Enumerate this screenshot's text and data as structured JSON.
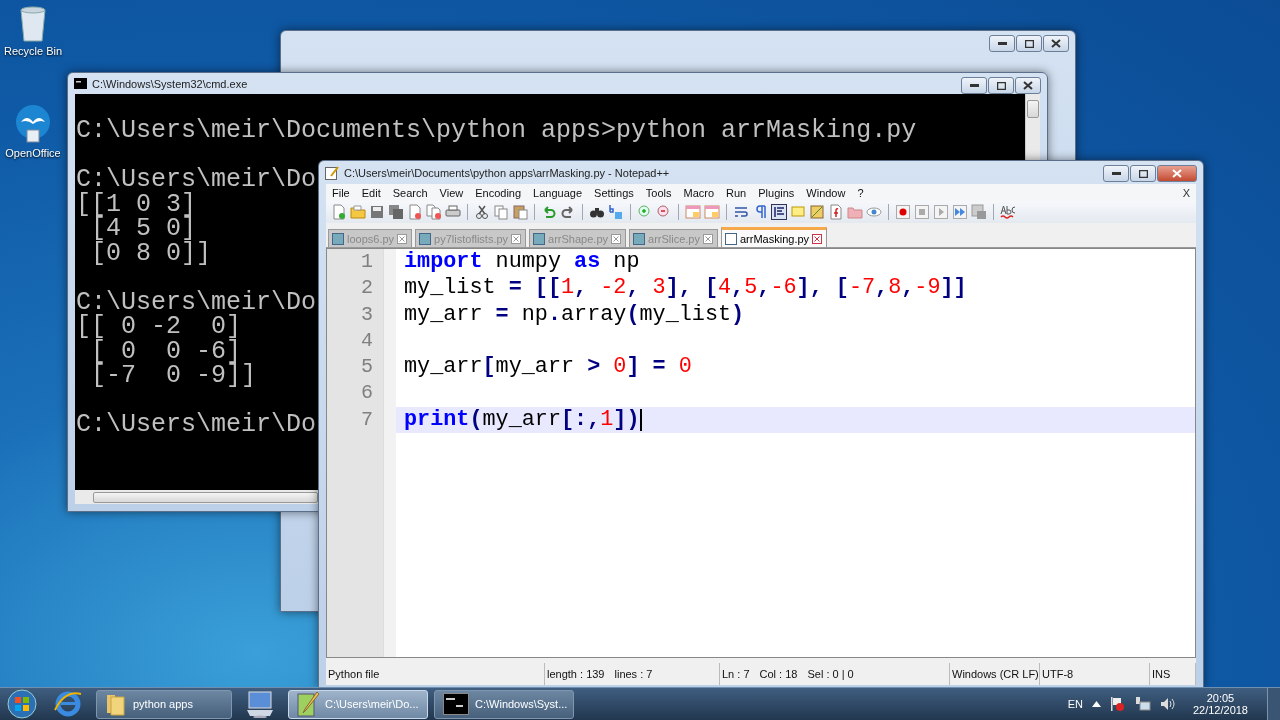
{
  "desktop_icons": [
    {
      "label": "Recycle Bin",
      "kind": "recycle"
    },
    {
      "label": "OpenOffice",
      "kind": "office"
    }
  ],
  "cmd_window": {
    "title": "C:\\Windows\\System32\\cmd.exe",
    "blocks": [
      [
        "C:\\Users\\meir\\Documents\\python apps>python arrMasking.py"
      ],
      [
        "C:\\Users\\meir\\Do",
        "[[1 0 3]",
        " [4 5 0]",
        " [0 8 0]]"
      ],
      [
        "C:\\Users\\meir\\Do",
        "[[ 0 -2  0]",
        " [ 0  0 -6]",
        " [-7  0 -9]]"
      ],
      [
        "C:\\Users\\meir\\Do"
      ]
    ]
  },
  "editor_window": {
    "title": "C:\\Users\\meir\\Documents\\python apps\\arrMasking.py - Notepad++",
    "menu": [
      "File",
      "Edit",
      "Search",
      "View",
      "Encoding",
      "Language",
      "Settings",
      "Tools",
      "Macro",
      "Run",
      "Plugins",
      "Window",
      "?"
    ],
    "close_doc": "X",
    "tabs": [
      {
        "label": "loops6.py",
        "selected": false
      },
      {
        "label": "py7listoflists.py",
        "selected": false
      },
      {
        "label": "arrShape.py",
        "selected": false
      },
      {
        "label": "arrSlice.py",
        "selected": false
      },
      {
        "label": "arrMasking.py",
        "selected": true
      }
    ],
    "code_lines": [
      {
        "number": "1",
        "current": false,
        "tokens": [
          {
            "text": "import",
            "kind": "keyword"
          },
          {
            "text": " numpy ",
            "kind": "name"
          },
          {
            "text": "as",
            "kind": "keyword"
          },
          {
            "text": " np",
            "kind": "name"
          }
        ]
      },
      {
        "number": "2",
        "current": false,
        "tokens": [
          {
            "text": "my_list ",
            "kind": "name"
          },
          {
            "text": "= [[",
            "kind": "op"
          },
          {
            "text": "1",
            "kind": "number"
          },
          {
            "text": ",",
            "kind": "op"
          },
          {
            "text": " -2",
            "kind": "number"
          },
          {
            "text": ",",
            "kind": "op"
          },
          {
            "text": " 3",
            "kind": "number"
          },
          {
            "text": "], [",
            "kind": "op"
          },
          {
            "text": "4",
            "kind": "number"
          },
          {
            "text": ",",
            "kind": "op"
          },
          {
            "text": "5",
            "kind": "number"
          },
          {
            "text": ",",
            "kind": "op"
          },
          {
            "text": "-6",
            "kind": "number"
          },
          {
            "text": "], [",
            "kind": "op"
          },
          {
            "text": "-7",
            "kind": "number"
          },
          {
            "text": ",",
            "kind": "op"
          },
          {
            "text": "8",
            "kind": "number"
          },
          {
            "text": ",",
            "kind": "op"
          },
          {
            "text": "-9",
            "kind": "number"
          },
          {
            "text": "]]",
            "kind": "op"
          }
        ]
      },
      {
        "number": "3",
        "current": false,
        "tokens": [
          {
            "text": "my_arr ",
            "kind": "name"
          },
          {
            "text": "=",
            "kind": "op"
          },
          {
            "text": " np",
            "kind": "name"
          },
          {
            "text": ".",
            "kind": "op"
          },
          {
            "text": "array",
            "kind": "name"
          },
          {
            "text": "(",
            "kind": "op"
          },
          {
            "text": "my_list",
            "kind": "name"
          },
          {
            "text": ")",
            "kind": "op"
          }
        ]
      },
      {
        "number": "4",
        "current": false
      },
      {
        "number": "5",
        "current": false,
        "tokens": [
          {
            "text": "my_arr",
            "kind": "name"
          },
          {
            "text": "[",
            "kind": "op"
          },
          {
            "text": "my_arr ",
            "kind": "name"
          },
          {
            "text": ">",
            "kind": "op"
          },
          {
            "text": " 0",
            "kind": "number"
          },
          {
            "text": "] = ",
            "kind": "op"
          },
          {
            "text": "0",
            "kind": "number"
          }
        ]
      },
      {
        "number": "6",
        "current": false
      },
      {
        "number": "7",
        "current": true,
        "tokens": [
          {
            "text": "print",
            "kind": "keyword"
          },
          {
            "text": "(",
            "kind": "op"
          },
          {
            "text": "my_arr",
            "kind": "name"
          },
          {
            "text": "[:,",
            "kind": "op"
          },
          {
            "text": "1",
            "kind": "number"
          },
          {
            "text": "])",
            "kind": "op"
          }
        ]
      }
    ],
    "status_bar": {
      "file_type": "Python file",
      "length": "length : 139",
      "lines": "lines : 7",
      "ln": "Ln : 7",
      "col": "Col : 18",
      "sel": "Sel : 0 | 0",
      "eol": "Windows (CR LF)",
      "encoding": "UTF-8",
      "mode": "INS"
    }
  },
  "taskbar": {
    "items": [
      {
        "kind": "browser",
        "selected": false
      },
      {
        "kind": "folder",
        "label": "python apps",
        "selected": false
      },
      {
        "kind": "computer",
        "selected": false
      },
      {
        "kind": "editor",
        "label": "C:\\Users\\meir\\Do...",
        "selected": true
      },
      {
        "kind": "console",
        "label": "C:\\Windows\\Syst...",
        "selected": false
      }
    ],
    "language": "EN",
    "time": "20:05",
    "date": "22/12/2018"
  }
}
